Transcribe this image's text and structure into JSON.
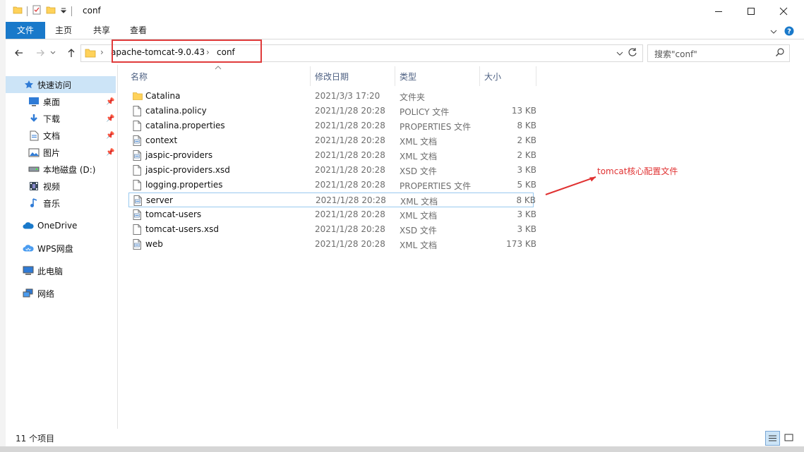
{
  "window": {
    "title": "conf"
  },
  "ribbon": {
    "tabs": [
      "文件",
      "主页",
      "共享",
      "查看"
    ]
  },
  "address": {
    "crumbs": [
      "apache-tomcat-9.0.43",
      "conf"
    ]
  },
  "search": {
    "placeholder": "搜索\"conf\""
  },
  "nav": {
    "items": [
      {
        "label": "快速访问",
        "icon": "star-icon"
      },
      {
        "label": "桌面",
        "icon": "desktop-icon"
      },
      {
        "label": "下载",
        "icon": "download-icon"
      },
      {
        "label": "文档",
        "icon": "document-icon"
      },
      {
        "label": "图片",
        "icon": "picture-icon"
      },
      {
        "label": "本地磁盘 (D:)",
        "icon": "drive-icon"
      },
      {
        "label": "视频",
        "icon": "video-icon"
      },
      {
        "label": "音乐",
        "icon": "music-icon"
      },
      {
        "label": "OneDrive",
        "icon": "cloud-icon"
      },
      {
        "label": "WPS网盘",
        "icon": "wps-cloud-icon"
      },
      {
        "label": "此电脑",
        "icon": "computer-icon"
      },
      {
        "label": "网络",
        "icon": "network-icon"
      }
    ]
  },
  "columns": {
    "name": "名称",
    "date": "修改日期",
    "type": "类型",
    "size": "大小"
  },
  "files": [
    {
      "name": "Catalina",
      "date": "2021/3/3 17:20",
      "type": "文件夹",
      "size": "",
      "icon": "folder-icon"
    },
    {
      "name": "catalina.policy",
      "date": "2021/1/28 20:28",
      "type": "POLICY 文件",
      "size": "13 KB",
      "icon": "file-icon"
    },
    {
      "name": "catalina.properties",
      "date": "2021/1/28 20:28",
      "type": "PROPERTIES 文件",
      "size": "8 KB",
      "icon": "file-icon"
    },
    {
      "name": "context",
      "date": "2021/1/28 20:28",
      "type": "XML 文档",
      "size": "2 KB",
      "icon": "xml-file-icon"
    },
    {
      "name": "jaspic-providers",
      "date": "2021/1/28 20:28",
      "type": "XML 文档",
      "size": "2 KB",
      "icon": "xml-file-icon"
    },
    {
      "name": "jaspic-providers.xsd",
      "date": "2021/1/28 20:28",
      "type": "XSD 文件",
      "size": "3 KB",
      "icon": "file-icon"
    },
    {
      "name": "logging.properties",
      "date": "2021/1/28 20:28",
      "type": "PROPERTIES 文件",
      "size": "5 KB",
      "icon": "file-icon"
    },
    {
      "name": "server",
      "date": "2021/1/28 20:28",
      "type": "XML 文档",
      "size": "8 KB",
      "icon": "xml-file-icon"
    },
    {
      "name": "tomcat-users",
      "date": "2021/1/28 20:28",
      "type": "XML 文档",
      "size": "3 KB",
      "icon": "xml-file-icon"
    },
    {
      "name": "tomcat-users.xsd",
      "date": "2021/1/28 20:28",
      "type": "XSD 文件",
      "size": "3 KB",
      "icon": "file-icon"
    },
    {
      "name": "web",
      "date": "2021/1/28 20:28",
      "type": "XML 文档",
      "size": "173 KB",
      "icon": "xml-file-icon"
    }
  ],
  "annotation": {
    "text": "tomcat核心配置文件",
    "color": "#e03131"
  },
  "status": {
    "count": "11 个项目"
  },
  "colors": {
    "accent": "#1979ca",
    "selection": "#cce4f7",
    "highlight_box": "#e03b3b"
  }
}
